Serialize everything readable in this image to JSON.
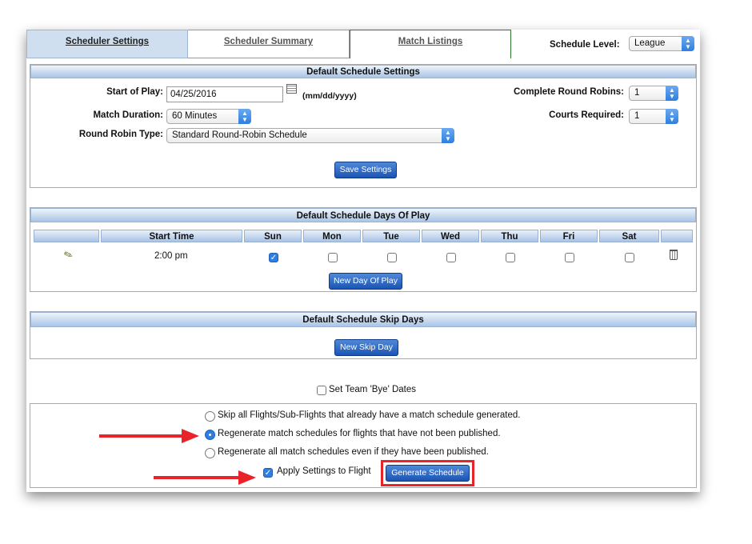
{
  "tabs": [
    {
      "label": "Scheduler Settings"
    },
    {
      "label": "Scheduler Summary"
    },
    {
      "label": "Match Listings"
    }
  ],
  "schedule_level": {
    "label": "Schedule Level:",
    "value": "League"
  },
  "default_settings": {
    "title": "Default Schedule Settings",
    "start_of_play_label": "Start of Play:",
    "start_of_play_value": "04/25/2016",
    "date_format": "(mm/dd/yyyy)",
    "match_duration_label": "Match Duration:",
    "match_duration_value": "60 Minutes",
    "round_robin_type_label": "Round Robin Type:",
    "round_robin_type_value": "Standard Round-Robin Schedule",
    "complete_round_robins_label": "Complete Round Robins:",
    "complete_round_robins_value": "1",
    "courts_required_label": "Courts Required:",
    "courts_required_value": "1",
    "save_button": "Save Settings"
  },
  "days_of_play": {
    "title": "Default Schedule Days Of Play",
    "columns": [
      "Start Time",
      "Sun",
      "Mon",
      "Tue",
      "Wed",
      "Thu",
      "Fri",
      "Sat"
    ],
    "rows": [
      {
        "start_time": "2:00 pm",
        "days": [
          true,
          false,
          false,
          false,
          false,
          false,
          false
        ]
      }
    ],
    "new_button": "New Day Of Play"
  },
  "skip_days": {
    "title": "Default Schedule Skip Days",
    "new_button": "New Skip Day"
  },
  "bye_dates": {
    "label": "Set Team 'Bye' Dates",
    "checked": false
  },
  "regenerate_options": [
    {
      "label": "Skip all Flights/Sub-Flights that already have a match schedule generated.",
      "selected": false
    },
    {
      "label": "Regenerate match schedules for flights that have not been published.",
      "selected": true
    },
    {
      "label": "Regenerate all match schedules even if they have been published.",
      "selected": false
    }
  ],
  "apply_settings": {
    "label": "Apply Settings to Flight",
    "checked": true
  },
  "generate_button": "Generate Schedule",
  "colors": {
    "accent_blue": "#2f7fe0",
    "annotation_red": "#e8232a",
    "header_blue": "#a9c4e6"
  }
}
